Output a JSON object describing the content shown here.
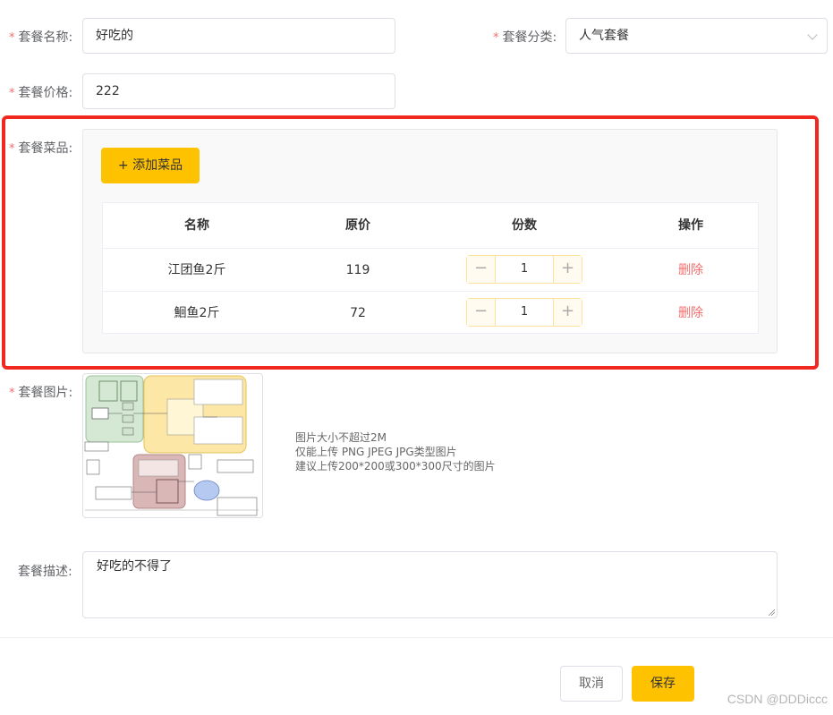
{
  "form": {
    "name_label": "套餐名称:",
    "name_value": "好吃的",
    "category_label": "套餐分类:",
    "category_value": "人气套餐",
    "price_label": "套餐价格:",
    "price_value": "222",
    "dishes_label": "套餐菜品:",
    "image_label": "套餐图片:",
    "desc_label": "套餐描述:",
    "desc_value": "好吃的不得了",
    "required_mark": "*"
  },
  "dishes": {
    "add_button": "+ 添加菜品",
    "columns": [
      "名称",
      "原价",
      "份数",
      "操作"
    ],
    "rows": [
      {
        "name": "江团鱼2斤",
        "price": "119",
        "qty": "1",
        "action": "删除"
      },
      {
        "name": "鮰鱼2斤",
        "price": "72",
        "qty": "1",
        "action": "删除"
      }
    ],
    "minus": "−",
    "plus": "+"
  },
  "upload_tips": {
    "line1": "图片大小不超过2M",
    "line2": "仅能上传 PNG JPEG JPG类型图片",
    "line3": "建议上传200*200或300*300尺寸的图片"
  },
  "footer": {
    "cancel_label": "取消",
    "save_label": "保存"
  },
  "watermark": "CSDN @DDDiccc",
  "colors": {
    "accent": "#ffc200",
    "required": "#f56c6c",
    "highlight_border": "#f0281f",
    "delete_link": "#f56c6c"
  }
}
